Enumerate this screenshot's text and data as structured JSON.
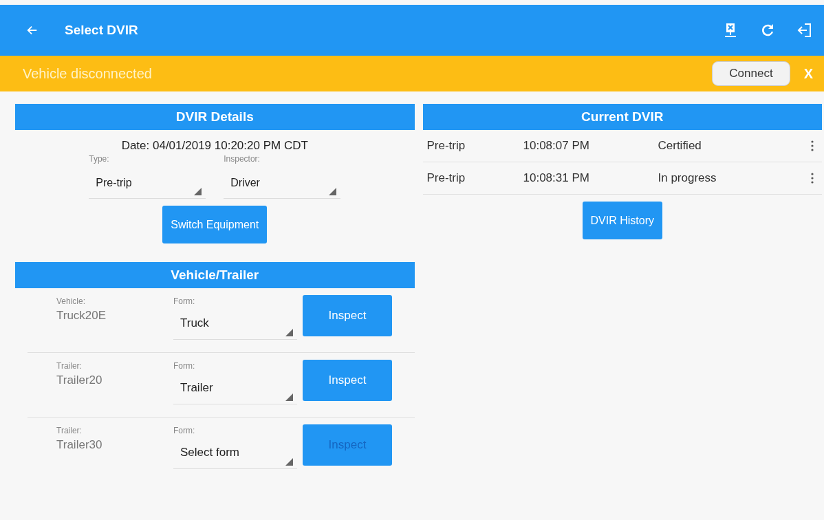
{
  "app_bar": {
    "title": "Select DVIR"
  },
  "banner": {
    "message": "Vehicle disconnected",
    "button": "Connect",
    "close": "X"
  },
  "dvir_details": {
    "title": "DVIR Details",
    "date": "Date: 04/01/2019 10:20:20 PM CDT",
    "fields": [
      {
        "label": "Type:",
        "value": "Pre-trip"
      },
      {
        "label": "Inspector:",
        "value": "Driver"
      }
    ],
    "button": "Switch Equipment"
  },
  "vehicle_trailer": {
    "title": "Vehicle/Trailer",
    "rows": [
      {
        "label": "Vehicle:",
        "name": "Truck20E",
        "form_label": "Form:",
        "form": "Truck",
        "button": "Inspect",
        "disabled": false
      },
      {
        "label": "Trailer:",
        "name": "Trailer20",
        "form_label": "Form:",
        "form": "Trailer",
        "button": "Inspect",
        "disabled": false
      },
      {
        "label": "Trailer:",
        "name": "Trailer30",
        "form_label": "Form:",
        "form": "Select form",
        "button": "Inspect",
        "disabled": true
      }
    ]
  },
  "current_dvir": {
    "title": "Current DVIR",
    "rows": [
      {
        "type": "Pre-trip",
        "time": "10:08:07 PM",
        "status": "Certified"
      },
      {
        "type": "Pre-trip",
        "time": "10:08:31 PM",
        "status": "In progress"
      }
    ],
    "button": "DVIR History"
  }
}
